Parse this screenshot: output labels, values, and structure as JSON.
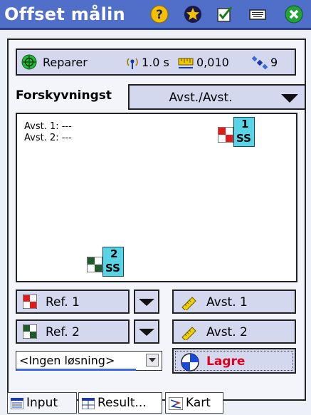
{
  "titlebar": {
    "title": "Offset målin",
    "icons": [
      "help-icon",
      "favorites-star-icon",
      "checklist-icon",
      "keyboard-icon",
      "close-icon"
    ]
  },
  "status": {
    "mode_label": "Reparer",
    "interval": "1.0 s",
    "precision": "0,010",
    "satellites": "9"
  },
  "method": {
    "label": "Forskyvningst",
    "value": "Avst./Avst."
  },
  "canvas": {
    "avst1": "Avst. 1: ---",
    "avst2": "Avst. 2: ---",
    "point1_number": "1",
    "point1_code": "SS",
    "point2_number": "2",
    "point2_code": "SS"
  },
  "buttons": {
    "ref1": "Ref. 1",
    "ref2": "Ref. 2",
    "avst1": "Avst. 1",
    "avst2": "Avst. 2",
    "solution": "<Ingen løsning>",
    "save": "Lagre"
  },
  "tabs": [
    "Input",
    "Result...",
    "Kart"
  ],
  "colors": {
    "titlebar": "#4f6fc9",
    "button_bg": "#d3d8ee",
    "save_text": "#e0001b",
    "point_teal": "#58d4e6"
  }
}
